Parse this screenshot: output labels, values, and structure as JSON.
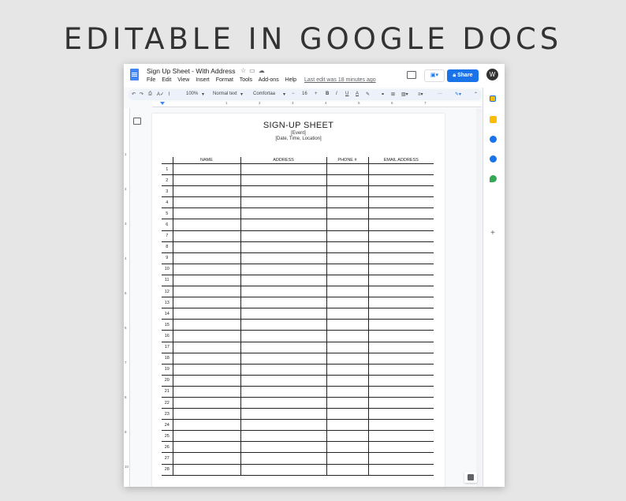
{
  "headline": "EDITABLE IN GOOGLE DOCS",
  "docs": {
    "title": "Sign Up Sheet - With Address",
    "menu": [
      "File",
      "Edit",
      "View",
      "Insert",
      "Format",
      "Tools",
      "Add-ons",
      "Help"
    ],
    "last_edit": "Last edit was 18 minutes ago",
    "share_label": "Share",
    "avatar_letter": "W",
    "toolbar": {
      "zoom": "100%",
      "style": "Normal text",
      "font": "Comfortaa",
      "font_size": "16",
      "bold": "B",
      "italic": "I",
      "underline": "U",
      "text_color": "A",
      "more": "···"
    },
    "ruler_marks": [
      "1",
      "2",
      "3",
      "4",
      "5",
      "6",
      "7"
    ],
    "vruler_marks": [
      "1",
      "2",
      "3",
      "4",
      "5",
      "6",
      "7",
      "8",
      "9",
      "10"
    ]
  },
  "sheet": {
    "title": "SIGN-UP SHEET",
    "event": "[Event]",
    "details": "[Date, Time, Location]",
    "columns": [
      "",
      "NAME",
      "ADDRESS",
      "PHONE #",
      "EMAIL ADDRESS"
    ],
    "rows": [
      "1",
      "2",
      "3",
      "4",
      "5",
      "6",
      "7",
      "8",
      "9",
      "10",
      "11",
      "12",
      "13",
      "14",
      "15",
      "16",
      "17",
      "18",
      "19",
      "20",
      "21",
      "22",
      "23",
      "24",
      "25",
      "26",
      "27",
      "28"
    ]
  },
  "colors": {
    "accent": "#1a73e8",
    "doc_icon": "#4285f4",
    "keep": "#fbbc04",
    "tasks": "#1a73e8",
    "contacts": "#1a73e8",
    "maps": "#34a853"
  }
}
